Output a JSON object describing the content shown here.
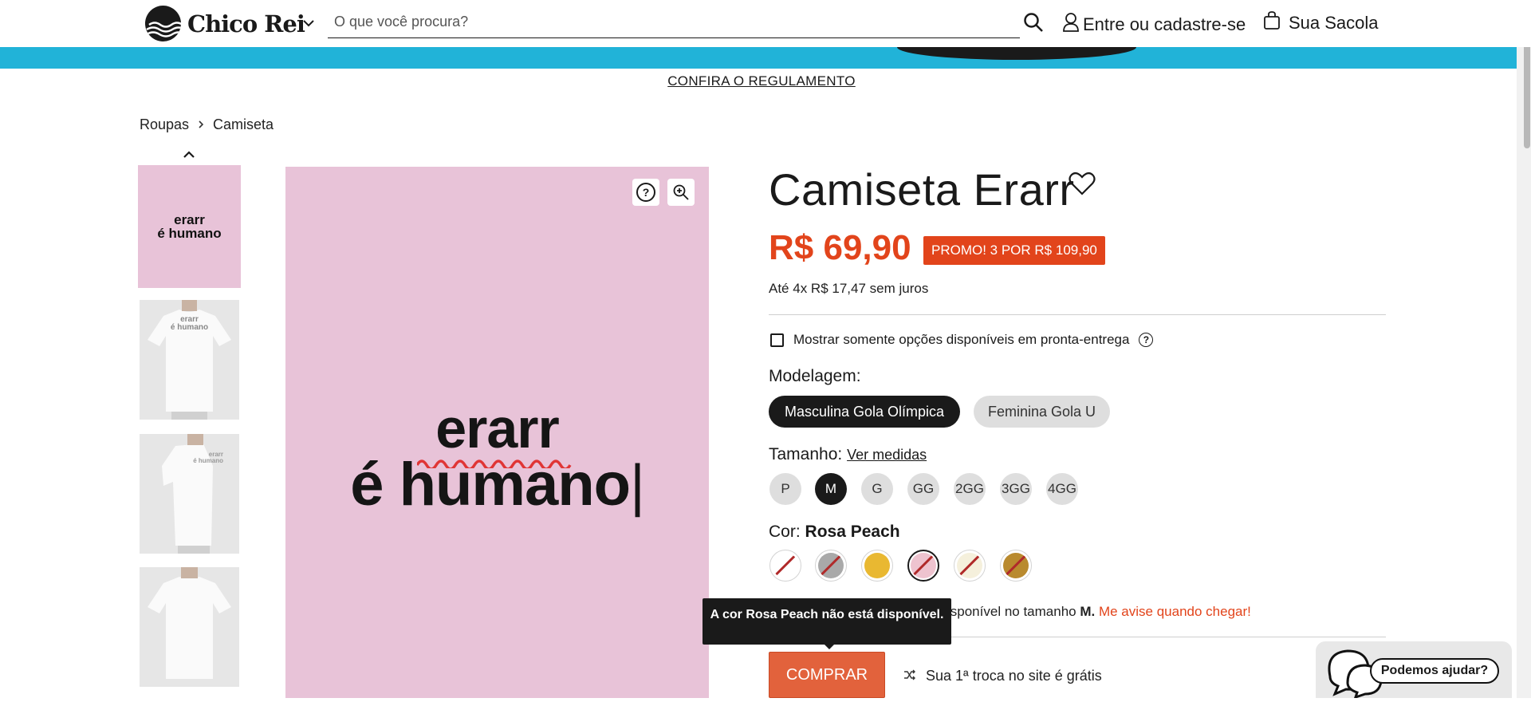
{
  "header": {
    "logo_text": "Chico Rei",
    "search_placeholder": "O que você procura?",
    "account_label": "Entre ou cadastre-se",
    "bag_label": "Sua Sacola"
  },
  "banner": {
    "regulamento_link": "CONFIRA O REGULAMENTO",
    "color": "#21b3d8"
  },
  "breadcrumb": [
    "Roupas",
    "Camiseta"
  ],
  "gallery": {
    "thumbnails": [
      {
        "line1": "erarr",
        "line2": "é humano"
      },
      {
        "line1": "erarr",
        "line2": "é humano"
      },
      {
        "line1": "erarr",
        "line2": "é humano"
      },
      {
        "line1": "",
        "line2": ""
      }
    ],
    "main_line1": "erarr",
    "main_line2": "é humano",
    "main_background": "#e8c3d8"
  },
  "product": {
    "title": "Camiseta Erarr",
    "price": "R$ 69,90",
    "promo": "PROMO! 3 POR R$ 109,90",
    "installments": "Até 4x R$ 17,47 sem juros",
    "availability_filter": "Mostrar somente opções disponíveis em pronta-entrega",
    "modelagem_label": "Modelagem:",
    "modelagem_options": [
      "Masculina Gola Olímpica",
      "Feminina Gola U"
    ],
    "modelagem_selected": "Masculina Gola Olímpica",
    "tamanho_label": "Tamanho:",
    "ver_medidas": "Ver medidas",
    "sizes": [
      "P",
      "M",
      "G",
      "GG",
      "2GG",
      "3GG",
      "4GG"
    ],
    "size_selected": "M",
    "cor_label": "Cor:",
    "cor_selected": "Rosa Peach",
    "colors": [
      {
        "name": "Branco",
        "hex": "#ffffff",
        "available": false
      },
      {
        "name": "Cinza",
        "hex": "#a9a9a9",
        "available": false
      },
      {
        "name": "Amarelo",
        "hex": "#e9b831",
        "available": true
      },
      {
        "name": "Rosa Peach",
        "hex": "#eec3cf",
        "available": false
      },
      {
        "name": "Off White",
        "hex": "#f5f0dc",
        "available": false
      },
      {
        "name": "Caramelo",
        "hex": "#b98a2e",
        "available": false
      }
    ],
    "unavailable_text": "isponível no tamanho",
    "unavailable_size": "M.",
    "notify_link": "Me avise quando chegar!",
    "tooltip": "A cor Rosa Peach não está disponível.",
    "buy_button": "COMPRAR",
    "exchange_text": "Sua 1ª troca no site é grátis"
  },
  "help_widget": {
    "label": "Podemos ajudar?"
  },
  "colors": {
    "accent": "#e2441b",
    "buy_button": "#e2623c",
    "dark": "#1a1a1a"
  }
}
